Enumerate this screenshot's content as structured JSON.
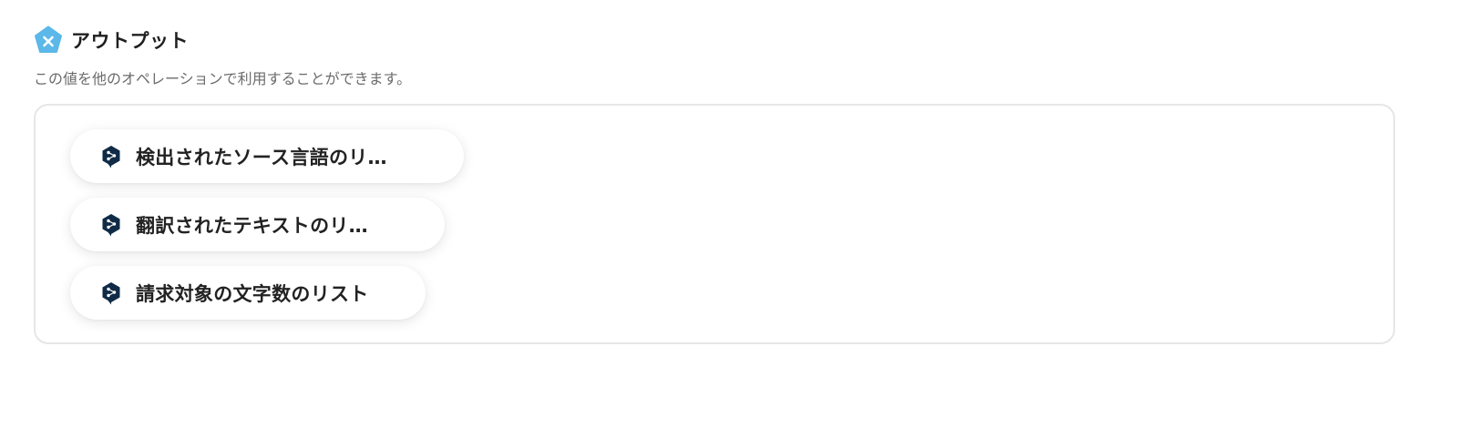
{
  "output": {
    "title": "アウトプット",
    "description": "この値を他のオペレーションで利用することができます。",
    "header_icon": "variable-pentagon-icon",
    "colors": {
      "header_icon": "#5bb8e8",
      "chip_icon": "#0f2b46",
      "border": "#e6e6e6"
    },
    "items": [
      {
        "label": "検出されたソース言語のリ…",
        "icon": "deepl-icon"
      },
      {
        "label": "翻訳されたテキストのリ…",
        "icon": "deepl-icon"
      },
      {
        "label": "請求対象の文字数のリスト",
        "icon": "deepl-icon"
      }
    ]
  }
}
